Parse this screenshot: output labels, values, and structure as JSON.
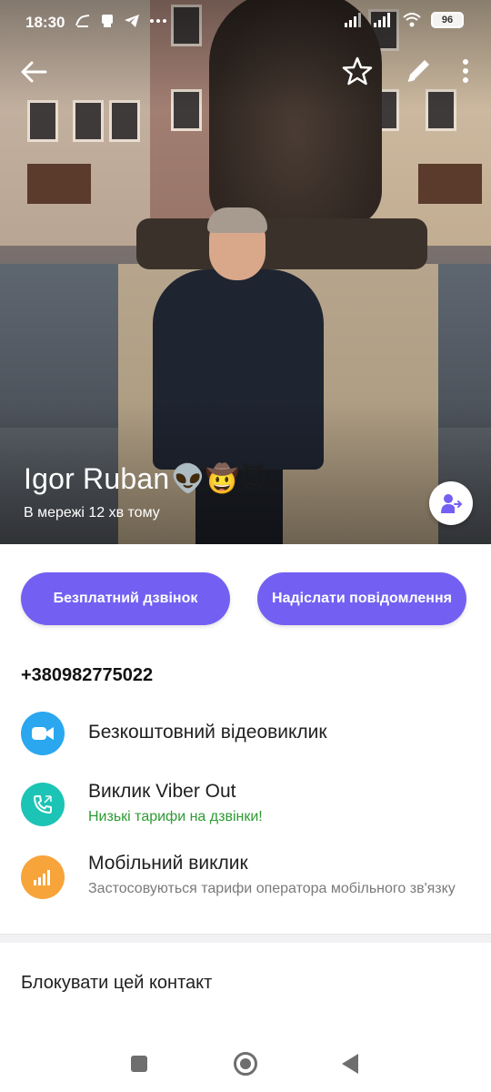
{
  "status_bar": {
    "time": "18:30",
    "left_icons": [
      "wave-icon",
      "notification-icon",
      "telegram-icon",
      "more-dots-icon"
    ],
    "battery": "96"
  },
  "contact": {
    "name": "Igor Ruban",
    "name_emojis": "👽🤠😈",
    "presence": "В мережі 12 хв тому"
  },
  "actions": {
    "free_call": "Безплатний дзвінок",
    "send_message": "Надіслати повідомлення"
  },
  "phone_number": "+380982775022",
  "options": [
    {
      "icon": "video-camera-icon",
      "title": "Безкоштовний відеовиклик",
      "subtitle": "",
      "color": "#2aa7ef"
    },
    {
      "icon": "viber-out-phone-icon",
      "title": "Виклик Viber Out",
      "subtitle": "Низькі тарифи на дзвінки!",
      "subtitle_color": "#2e9b33",
      "color": "#1cc4b5"
    },
    {
      "icon": "signal-bars-icon",
      "title": "Мобільний виклик",
      "subtitle": "Застосовуються тарифи оператора мобільного зв'язку",
      "subtitle_color": "#7a7a7a",
      "color": "#f7a43b"
    }
  ],
  "block_contact": "Блокувати цей контакт",
  "colors": {
    "accent": "#7360f2"
  }
}
